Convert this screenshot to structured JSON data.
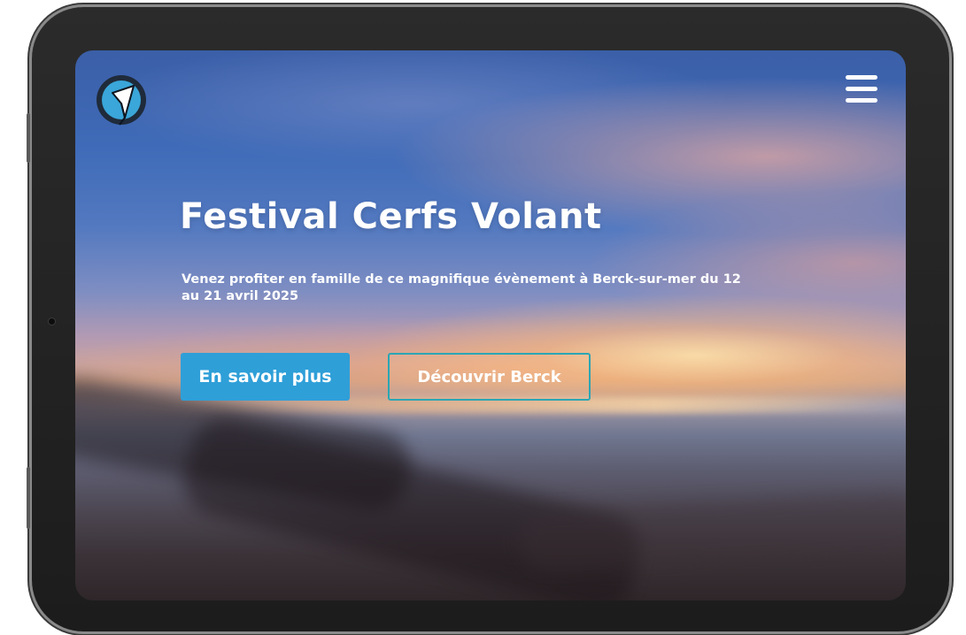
{
  "header": {
    "logo_icon": "kite-logo-icon",
    "menu_icon": "hamburger-menu-icon"
  },
  "hero": {
    "title": "Festival Cerfs Volant",
    "subtitle": "Venez profiter en famille de ce magnifique évènement à Berck-sur-mer du 12 au 21 avril 2025",
    "primary_button": "En savoir plus",
    "secondary_button": "Découvrir Berck"
  },
  "colors": {
    "primary_button_bg": "#2f9fd8",
    "outline_button_border": "#2ba6b4",
    "text": "#ffffff",
    "device_frame": "#232323"
  }
}
